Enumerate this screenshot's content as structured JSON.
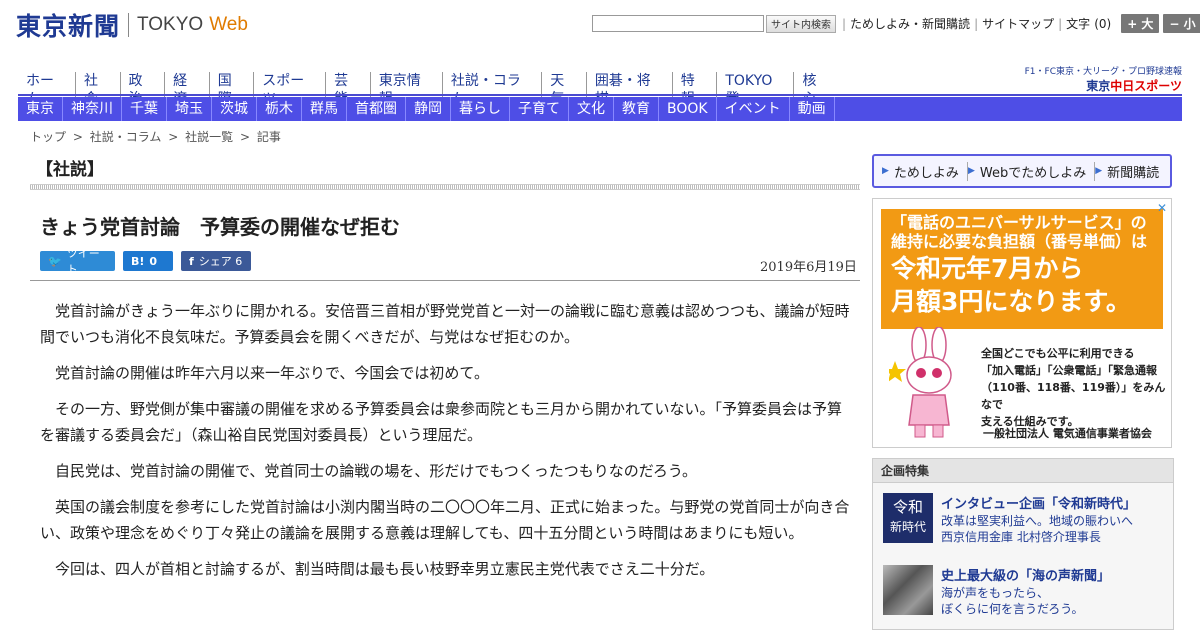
{
  "header": {
    "logo_jp": "東京新聞",
    "logo_en": "TOKYO",
    "logo_web": "Web",
    "search_button": "サイト内検索",
    "search_value": "",
    "links": [
      "ためしよみ・新聞購読",
      "サイトマップ"
    ],
    "font_size_label": "文字",
    "font_size_value": "(0)",
    "font_bigger": "+ 大",
    "font_smaller": "− 小"
  },
  "main_nav": [
    "ホーム",
    "社会",
    "政治",
    "経済",
    "国際",
    "スポーツ",
    "芸能",
    "東京情報",
    "社説・コラム",
    "天気",
    "囲碁・将棋",
    "特報",
    "TOKYO発",
    "核心"
  ],
  "sports": {
    "top": "F1・FC東京・大リーグ・プロ野球速報",
    "logo_pre": "東京",
    "logo_main": "中日スポーツ"
  },
  "sub_nav": [
    "東京",
    "神奈川",
    "千葉",
    "埼玉",
    "茨城",
    "栃木",
    "群馬",
    "首都圏",
    "静岡",
    "暮らし",
    "子育て",
    "文化",
    "教育",
    "BOOK",
    "イベント",
    "動画"
  ],
  "breadcrumb": [
    "トップ",
    ">",
    "社説・コラム",
    ">",
    "社説一覧",
    ">",
    "記事"
  ],
  "article": {
    "section": "【社説】",
    "headline": "きょう党首討論　予算委の開催なぜ拒む",
    "date": "2019年6月19日",
    "social": {
      "tweet_label": "ツイート",
      "hatena_label": "B!",
      "hatena_count": "0",
      "fb_label": "シェア",
      "fb_count": "6"
    },
    "paragraphs": [
      "党首討論がきょう一年ぶりに開かれる。安倍晋三首相が野党党首と一対一の論戦に臨む意義は認めつつも、議論が短時間でいつも消化不良気味だ。予算委員会を開くべきだが、与党はなぜ拒むのか。",
      "党首討論の開催は昨年六月以来一年ぶりで、今国会では初めて。",
      "その一方、野党側が集中審議の開催を求める予算委員会は衆参両院とも三月から開かれていない。「予算委員会は予算を審議する委員会だ」（森山裕自民党国対委員長）という理屈だ。",
      "自民党は、党首討論の開催で、党首同士の論戦の場を、形だけでもつくったつもりなのだろう。",
      "英国の議会制度を参考にした党首討論は小渕内閣当時の二〇〇〇年二月、正式に始まった。与野党の党首同士が向き合い、政策や理念をめぐり丁々発止の議論を展開する意義は理解しても、四十五分間という時間はあまりにも短い。",
      "今回は、四人が首相と討論するが、割当時間は最も長い枝野幸男立憲民主党代表でさえ二十分だ。"
    ]
  },
  "promo_bar": [
    "ためしよみ",
    "Webでためしよみ",
    "新聞購読"
  ],
  "ad": {
    "line1a": "「電話のユニバーサルサービス」の",
    "line1b": "維持に必要な負担額（番号単価）は",
    "line2a": "令和元年7月から",
    "line2b": "月額3円になります。",
    "small": [
      "全国どこでも公平に利用できる",
      "「加入電話」「公衆電話」「緊急通報",
      "（110番、118番、119番）」をみんなで",
      "支える仕組みです。"
    ],
    "org": "一般社団法人 電気通信事業者協会",
    "close": "✕"
  },
  "feature": {
    "title": "企画特集",
    "items": [
      {
        "thumb_top": "令和",
        "thumb_bottom": "新時代",
        "title": "インタビュー企画「令和新時代」",
        "sub1": "改革は堅実利益へ。地域の賑わいへ",
        "sub2": "西京信用金庫 北村啓介理事長"
      },
      {
        "title": "史上最大級の「海の声新聞」",
        "sub1": "海が声をもったら、",
        "sub2": "ぼくらに何を言うだろう。"
      }
    ]
  },
  "colors": {
    "brand_blue": "#1f3a93",
    "subnav": "#4e4ee6",
    "ad_orange": "#f29a14",
    "web_orange": "#e07b00"
  }
}
